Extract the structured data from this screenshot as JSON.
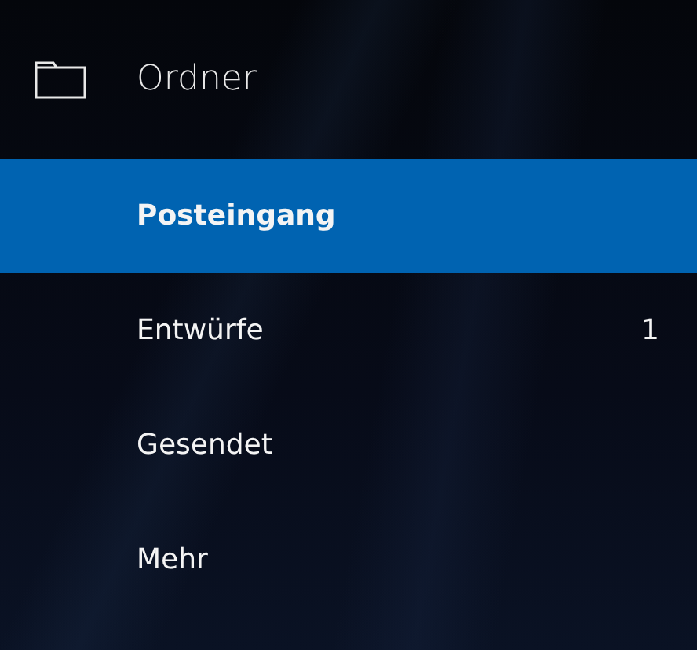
{
  "header": {
    "title": "Ordner"
  },
  "folders": [
    {
      "label": "Posteingang",
      "selected": true
    },
    {
      "label": "Entwürfe",
      "selected": false,
      "count": "1"
    },
    {
      "label": "Gesendet",
      "selected": false
    },
    {
      "label": "Mehr",
      "selected": false
    }
  ]
}
